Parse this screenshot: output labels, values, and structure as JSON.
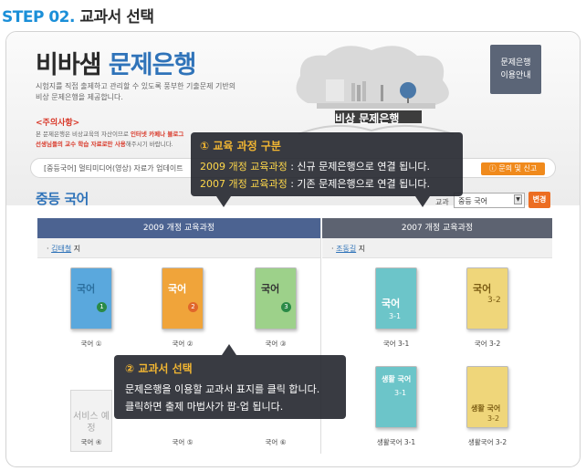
{
  "step": {
    "prefix": "STEP 02.",
    "title": "교과서 선택"
  },
  "hero": {
    "brand_main": "비바샘 ",
    "brand_accent": "문제은행",
    "intro_line1": "시험지를 직접 출제하고 관리할 수 있도록 풍부한 기출문제 기반의",
    "intro_line2": "비상 문제은행을 제공합니다.",
    "caution_title": "<주의사항>",
    "caution_line1_a": "본 문제은행은 비상교육의 자산이므로 ",
    "caution_line1_b": "인터넷 카페나 블로그",
    "caution_line2_a": "선생님들의 교수 학습 자료로만 사용",
    "caution_line2_b": "해주시기 바랍니다.",
    "shelf_title": "비상 문제은행",
    "guide_line1": "문제은행",
    "guide_line2": "이용안내"
  },
  "notice": {
    "text": "[중등국어] 멀티미디어(영상) 자료가 업데이트",
    "report_button": "문의 및 신고"
  },
  "subject": {
    "title": "중등 국어",
    "select_label": "교과",
    "select_value": "중등 국어",
    "change_button": "변경"
  },
  "tabs": [
    {
      "label": "2009 개정 교육과정"
    },
    {
      "label": "2007 개정 교육과정"
    }
  ],
  "authors": [
    {
      "name": "김태철",
      "suffix": " 지"
    },
    {
      "name": "조동길",
      "suffix": " 지"
    }
  ],
  "books_2009": [
    {
      "caption": "국어 ①",
      "cover_text": "국어",
      "num": "1",
      "color": "#5aa8dd"
    },
    {
      "caption": "국어 ②",
      "cover_text": "국어",
      "num": "2",
      "color": "#f0a43a"
    },
    {
      "caption": "국어 ③",
      "cover_text": "국어",
      "num": "3",
      "color": "#9dd18a"
    },
    {
      "caption": "국어 ④",
      "cover_text": "서비스 예정",
      "num": "",
      "color": "#f2f2f2"
    },
    {
      "caption": "국어 ⑤",
      "cover_text": "",
      "num": "",
      "color": "#e9e9e9"
    },
    {
      "caption": "국어 ⑥",
      "cover_text": "",
      "num": "",
      "color": "#e9e9e9"
    }
  ],
  "books_2007": [
    {
      "caption": "국어 3-1",
      "cover_text": "국어",
      "num": "3-1",
      "color": "#6cc5c9"
    },
    {
      "caption": "국어 3-2",
      "cover_text": "국어",
      "num": "3-2",
      "color": "#efd67a"
    },
    {
      "caption": "생활국어 3-1",
      "cover_text": "생활 국어",
      "num": "3-1",
      "color": "#6cc5c9"
    },
    {
      "caption": "생활국어 3-2",
      "cover_text": "생활 국어",
      "num": "3-2",
      "color": "#efd67a"
    }
  ],
  "tooltip1": {
    "title": "① 교육 과정 구분",
    "line1_key": "2009 개정 교육과정",
    "line1_rest": " : 신규 문제은행으로 연결 됩니다.",
    "line2_key": "2007 개정 교육과정",
    "line2_rest": " : 기존 문제은행으로 연결 됩니다."
  },
  "tooltip2": {
    "title": "② 교과서 선택",
    "line1": "문제은행을 이용할 교과서 표지를 클릭 합니다.",
    "line2": "클릭하면 출제 마법사가 팝-업 됩니다."
  }
}
